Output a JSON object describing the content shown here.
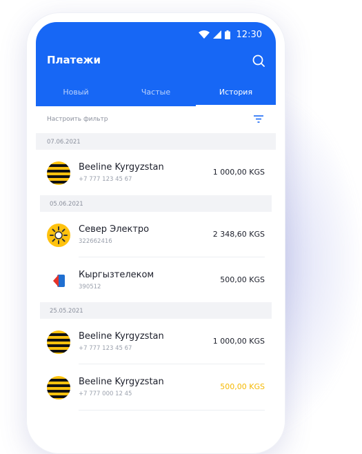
{
  "status_bar": {
    "time": "12:30"
  },
  "header": {
    "title": "Платежи"
  },
  "tabs": [
    {
      "label": "Новый",
      "active": false
    },
    {
      "label": "Частые",
      "active": false
    },
    {
      "label": "История",
      "active": true
    }
  ],
  "filter": {
    "label": "Настроить фильтр"
  },
  "groups": [
    {
      "date": "07.06.2021",
      "items": [
        {
          "name": "Beeline Kyrgyzstan",
          "sub": "+7 777 123 45 67",
          "amount": "1 000,00 KGS",
          "icon": "beeline-logo-icon"
        }
      ]
    },
    {
      "date": "05.06.2021",
      "items": [
        {
          "name": "Север Электро",
          "sub": "322662416",
          "amount": "2 348,60 KGS",
          "icon": "sever-elektro-logo-icon"
        },
        {
          "name": "Кыргызтелеком",
          "sub": "390512",
          "amount": "500,00 KGS",
          "icon": "kyrgyztelecom-logo-icon"
        }
      ]
    },
    {
      "date": "25.05.2021",
      "items": [
        {
          "name": "Beeline Kyrgyzstan",
          "sub": "+7 777 123 45 67",
          "amount": "1 000,00 KGS",
          "icon": "beeline-logo-icon"
        },
        {
          "name": "Beeline Kyrgyzstan",
          "sub": "+7 777 000 12 45",
          "amount": "500,00 KGS",
          "icon": "beeline-logo-icon",
          "status": "pending"
        }
      ]
    }
  ],
  "colors": {
    "primary": "#1767f5",
    "pending": "#f5b800",
    "separator_bg": "#f2f3f6"
  }
}
